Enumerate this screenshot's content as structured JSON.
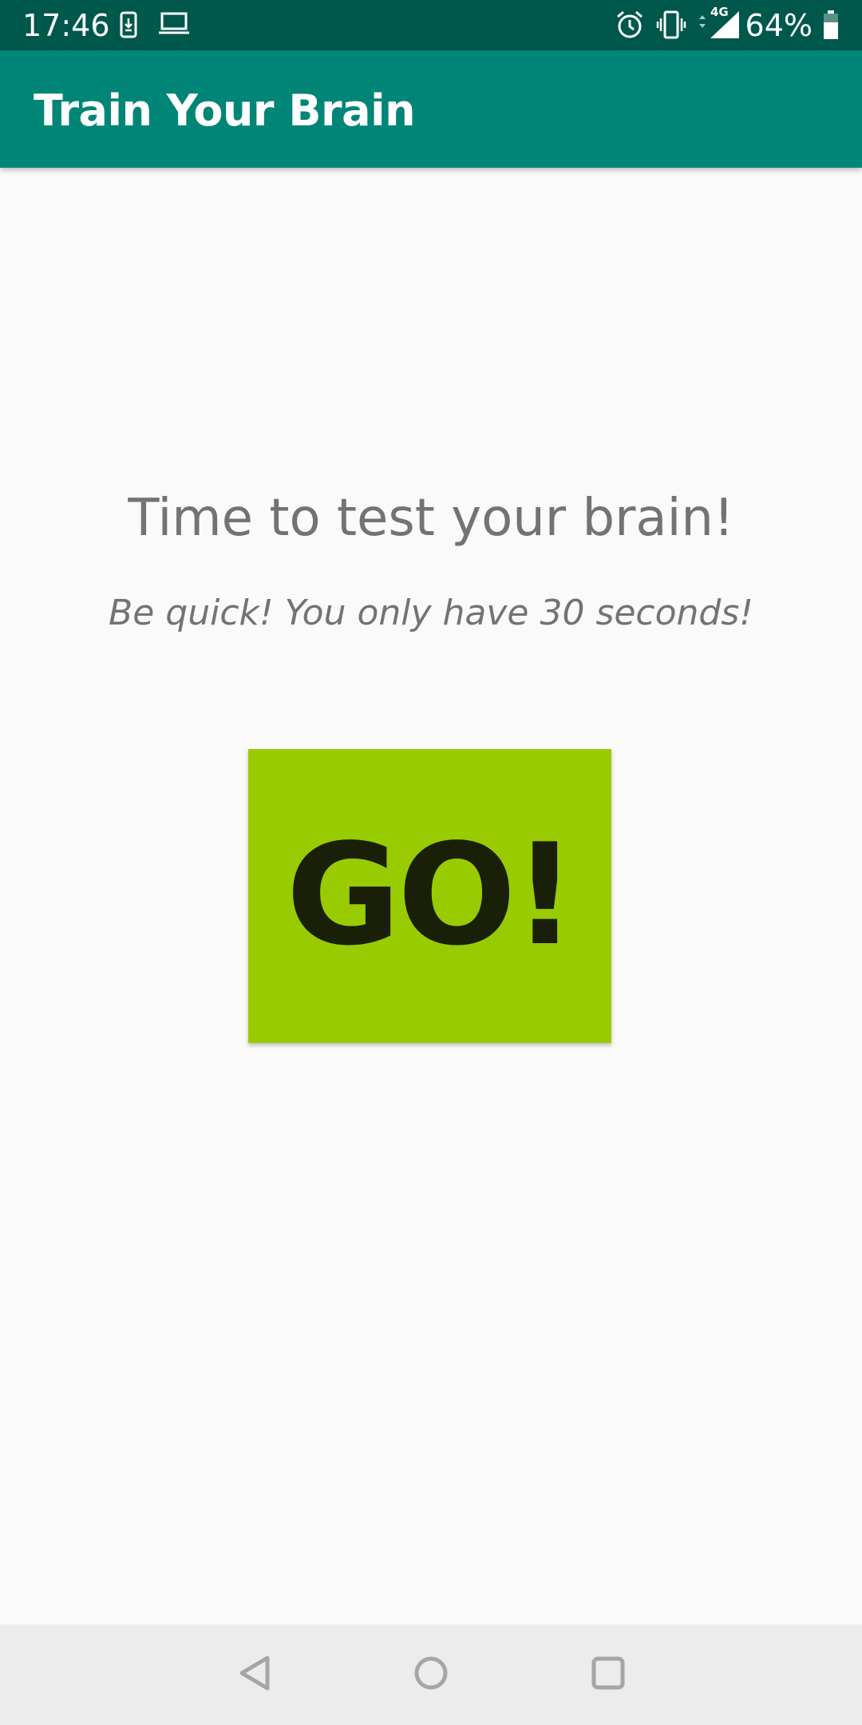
{
  "status_bar": {
    "time": "17:46",
    "battery_percent": "64%",
    "network_label": "4G",
    "icons": [
      "download-icon",
      "laptop-icon",
      "alarm-icon",
      "vibrate-icon",
      "signal-icon",
      "battery-icon"
    ],
    "background": "#00574b"
  },
  "app_bar": {
    "title": "Train Your Brain",
    "background": "#008577"
  },
  "content": {
    "headline": "Time to test your brain!",
    "subline": "Be quick! You only have 30 seconds!",
    "go_button_label": "GO!",
    "go_button_color": "#99cc00"
  },
  "nav_bar": {
    "icons": [
      "back-icon",
      "home-icon",
      "recents-icon"
    ]
  }
}
